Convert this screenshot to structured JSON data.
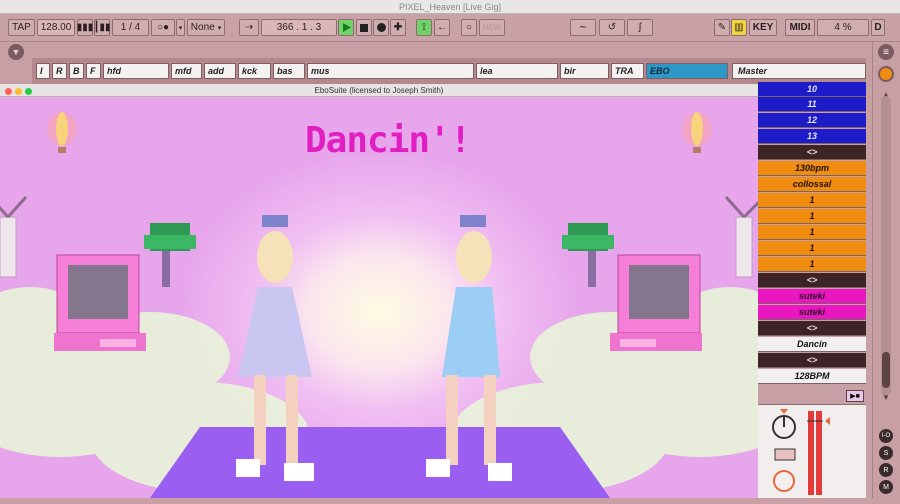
{
  "window": {
    "title": "PIXEL_Heaven  [Live Gig]"
  },
  "control_bar": {
    "tap": "TAP",
    "tempo": "128.00",
    "time_signature": "1 / 4",
    "quantize": "None",
    "position": "366 .   1 .   3",
    "new": "NEW",
    "key": "KEY",
    "midi": "MIDI",
    "cpu": "4 %",
    "d": "D"
  },
  "tracks": [
    {
      "name": "I"
    },
    {
      "name": "R"
    },
    {
      "name": "B"
    },
    {
      "name": "F"
    },
    {
      "name": "hfd"
    },
    {
      "name": "mfd"
    },
    {
      "name": "add"
    },
    {
      "name": "kck"
    },
    {
      "name": "bas"
    },
    {
      "name": "mus"
    },
    {
      "name": "lea"
    },
    {
      "name": "bir"
    },
    {
      "name": "TRA"
    },
    {
      "name": "EBO"
    }
  ],
  "master_label": "Master",
  "clips": [
    {
      "label": "10",
      "color": "blue"
    },
    {
      "label": "11",
      "color": "blue"
    },
    {
      "label": "12",
      "color": "blue"
    },
    {
      "label": "13",
      "color": "blue"
    },
    {
      "label": "<>",
      "color": "brown"
    },
    {
      "label": "130bpm",
      "color": "orange"
    },
    {
      "label": "collossal",
      "color": "orange"
    },
    {
      "label": "1",
      "color": "orange"
    },
    {
      "label": "1",
      "color": "orange"
    },
    {
      "label": "1",
      "color": "orange"
    },
    {
      "label": "1",
      "color": "orange"
    },
    {
      "label": "1",
      "color": "orange"
    },
    {
      "label": "<>",
      "color": "brown"
    },
    {
      "label": "suteki",
      "color": "magenta"
    },
    {
      "label": "suteki",
      "color": "magenta"
    },
    {
      "label": "<>",
      "color": "brown"
    },
    {
      "label": "Dancin",
      "color": "white"
    },
    {
      "label": "<>",
      "color": "brown"
    },
    {
      "label": "128BPM",
      "color": "white"
    }
  ],
  "plugin_window": {
    "title": "EboSuite (licensed to Joseph Smith)"
  },
  "scene": {
    "overlay_text": "Dancin'!"
  },
  "colors": {
    "accent_pink": "#e01ec2",
    "selected_track": "#2d98c8",
    "app_bg": "#c7a0a6"
  }
}
